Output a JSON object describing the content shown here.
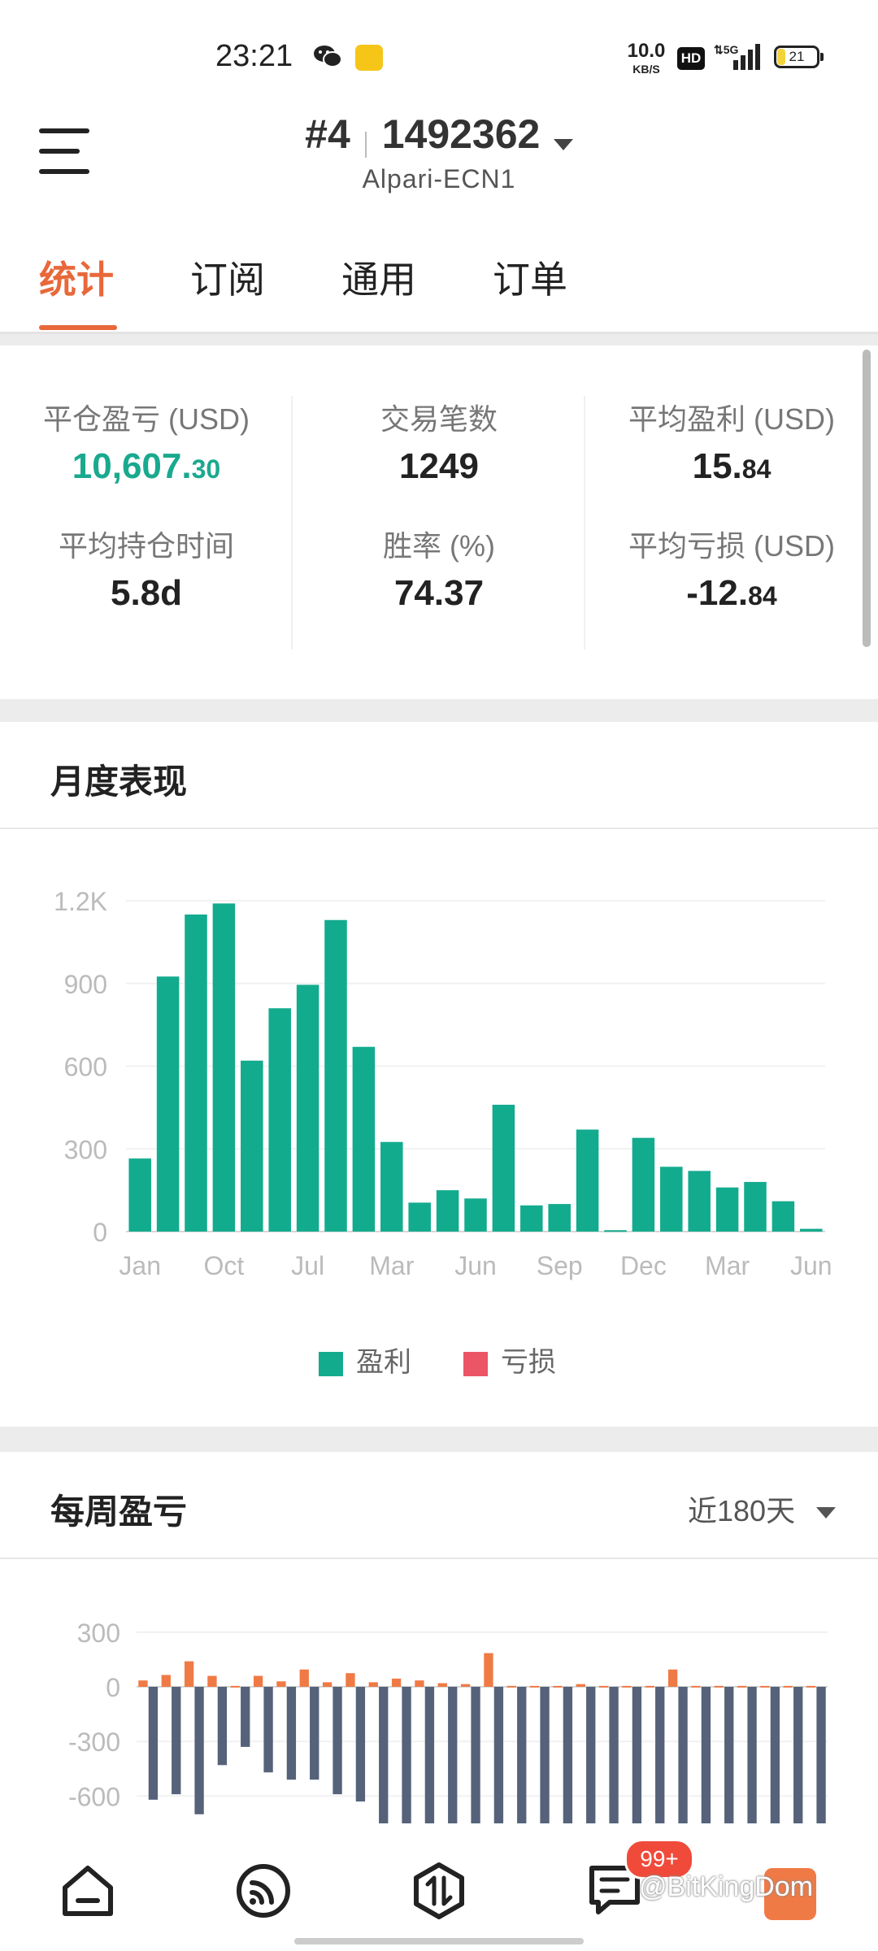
{
  "status_bar": {
    "time": "23:21",
    "net_speed": "10.0",
    "net_speed_unit": "KB/S",
    "hd": "HD",
    "network": "5G",
    "battery": "21"
  },
  "header": {
    "account_slot": "#4",
    "account_number": "1492362",
    "server": "Alpari-ECN1"
  },
  "tabs": [
    {
      "label": "统计",
      "active": true
    },
    {
      "label": "订阅",
      "active": false
    },
    {
      "label": "通用",
      "active": false
    },
    {
      "label": "订单",
      "active": false
    }
  ],
  "stats": {
    "closed_pl": {
      "label": "平仓盈亏 (USD)",
      "value_int": "10,607.",
      "value_dec": "30"
    },
    "trade_count": {
      "label": "交易笔数",
      "value": "1249"
    },
    "avg_profit": {
      "label": "平均盈利 (USD)",
      "value_int": "15.",
      "value_dec": "84"
    },
    "avg_hold_time": {
      "label": "平均持仓时间",
      "value": "5.8d"
    },
    "win_rate": {
      "label": "胜率 (%)",
      "value": "74.37"
    },
    "avg_loss": {
      "label": "平均亏损 (USD)",
      "value_int": "-12.",
      "value_dec": "84"
    }
  },
  "monthly": {
    "title": "月度表现",
    "legend_profit": "盈利",
    "legend_loss": "亏损"
  },
  "weekly": {
    "title": "每周盈亏",
    "range_selector": "近180天"
  },
  "bottom_nav": {
    "badge": "99+",
    "watermark": "@BitKingDom"
  },
  "colors": {
    "accent": "#e8683a",
    "profit": "#13ab8e",
    "loss": "#eb5565",
    "weekly_profit": "#f07a45",
    "weekly_loss": "#55627a"
  },
  "chart_data": [
    {
      "type": "bar",
      "x_tick_labels": [
        "Jan",
        "Oct",
        "Jul",
        "Mar",
        "Jun",
        "Sep",
        "Dec",
        "Mar",
        "Jun"
      ],
      "y_tick_labels": [
        "0",
        "300",
        "600",
        "900",
        "1.2K"
      ],
      "ylim": [
        0,
        1200
      ],
      "series": [
        {
          "name": "盈利",
          "values": [
            265,
            925,
            1150,
            1190,
            620,
            810,
            895,
            1130,
            670,
            325,
            105,
            150,
            120,
            460,
            95,
            100,
            370,
            5,
            340,
            235,
            220,
            160,
            180,
            110,
            10
          ]
        },
        {
          "name": "亏损",
          "values": []
        }
      ],
      "grid": true,
      "legend": "bottom-center"
    },
    {
      "type": "bar",
      "y_tick_labels": [
        "300",
        "0",
        "-300",
        "-600"
      ],
      "ylim": [
        -780,
        300
      ],
      "series": [
        {
          "values": [
            35,
            65,
            140,
            60,
            5,
            60,
            30,
            95,
            25,
            75,
            25,
            45,
            35,
            20,
            15,
            185,
            5,
            5,
            5,
            15,
            5,
            5,
            5,
            95,
            5,
            5,
            5,
            5,
            5,
            5
          ]
        },
        {
          "values": [
            -620,
            -590,
            -700,
            -430,
            -330,
            -470,
            -510,
            -510,
            -590,
            -630,
            -750,
            -750,
            -750,
            -750,
            -750,
            -750,
            -750,
            -750,
            -750,
            -750,
            -750,
            -750,
            -750,
            -750,
            -750,
            -750,
            -750,
            -750,
            -750,
            -750
          ]
        }
      ],
      "grid": true
    }
  ]
}
